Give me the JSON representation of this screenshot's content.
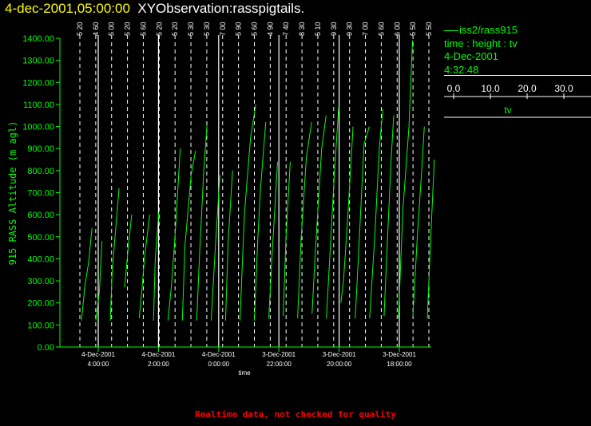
{
  "header": {
    "date_title": "4-dec-2001,05:00:00",
    "obs_title": "XYObservation:rasspigtails."
  },
  "legend": {
    "series": "iss2/rass915",
    "vars": "time : height : tv",
    "date": "4-Dec-2001",
    "time": "4:32:48",
    "scale_ticks": [
      "0.0",
      "10.0",
      "20.0",
      "30.0"
    ],
    "scale_label": "tv"
  },
  "footer": {
    "note": "Realtime data, not checked for quality"
  },
  "colors": {
    "title_date": "#ffff00",
    "title_obs": "#ffffff",
    "axis": "#00ff00",
    "trace": "#00ff00",
    "guide": "#ffffff",
    "footer": "#ff0000"
  },
  "chart_data": {
    "type": "line",
    "ylabel": "915 RASS Altitude (m agl)",
    "xlabel": "time",
    "ylim": [
      0,
      1400
    ],
    "y_ticks": [
      "0.00",
      "100.00",
      "200.00",
      "300.00",
      "400.00",
      "500.00",
      "600.00",
      "700.00",
      "800.00",
      "900.00",
      "1000.00",
      "1100.00",
      "1200.00",
      "1300.00",
      "1400.00"
    ],
    "x_ticks": [
      {
        "date": "4-Dec-2001",
        "time": "4:00:00"
      },
      {
        "date": "4-Dec-2001",
        "time": "2:00:00"
      },
      {
        "date": "4-Dec-2001",
        "time": "0:00:00"
      },
      {
        "date": "3-Dec-2001",
        "time": "22:00:00"
      },
      {
        "date": "3-Dec-2001",
        "time": "20:00:00"
      },
      {
        "date": "3-Dec-2001",
        "time": "18:00:00"
      }
    ],
    "profile_labels": [
      "5 20",
      "4 60",
      "5 00",
      "5 20",
      "5 60",
      "5 20",
      "5 20",
      "5 30",
      "5 30",
      "7 00",
      "5 90",
      "5 60",
      "4 90",
      "7 40",
      "8 30",
      "5 10",
      "9 30",
      "9 30",
      "7 00",
      "5 60",
      "6 00",
      "5 50",
      "5 50"
    ],
    "profiles": [
      {
        "points": [
          [
            0,
            120
          ],
          [
            0.4,
            280
          ],
          [
            0.8,
            380
          ],
          [
            1.2,
            540
          ]
        ]
      },
      {
        "points": [
          [
            0,
            120
          ],
          [
            0.4,
            250
          ],
          [
            0.7,
            480
          ]
        ]
      },
      {
        "points": [
          [
            0,
            120
          ],
          [
            0.2,
            330
          ],
          [
            0.6,
            530
          ],
          [
            1.0,
            720
          ]
        ]
      },
      {
        "points": [
          [
            0,
            270
          ],
          [
            0.4,
            450
          ],
          [
            0.8,
            600
          ]
        ]
      },
      {
        "points": [
          [
            0,
            130
          ],
          [
            0.3,
            250
          ],
          [
            0.6,
            400
          ],
          [
            1.2,
            600
          ]
        ]
      },
      {
        "points": [
          [
            0,
            120
          ],
          [
            0.2,
            400
          ],
          [
            0.6,
            610
          ]
        ]
      },
      {
        "points": [
          [
            0,
            120
          ],
          [
            0.4,
            280
          ],
          [
            0.8,
            500
          ],
          [
            1.4,
            900
          ]
        ]
      },
      {
        "points": [
          [
            0,
            120
          ],
          [
            0.3,
            460
          ],
          [
            1.0,
            780
          ],
          [
            1.5,
            890
          ]
        ]
      },
      {
        "points": [
          [
            0,
            120
          ],
          [
            0.3,
            400
          ],
          [
            0.8,
            800
          ],
          [
            1.2,
            1020
          ]
        ]
      },
      {
        "points": [
          [
            0,
            120
          ],
          [
            0.5,
            470
          ],
          [
            1.0,
            780
          ]
        ]
      },
      {
        "points": [
          [
            0,
            120
          ],
          [
            0.3,
            480
          ],
          [
            0.8,
            800
          ]
        ]
      },
      {
        "points": [
          [
            0,
            120
          ],
          [
            0.5,
            600
          ],
          [
            1.2,
            950
          ],
          [
            1.8,
            1100
          ]
        ]
      },
      {
        "points": [
          [
            0,
            120
          ],
          [
            0.4,
            500
          ],
          [
            0.7,
            720
          ],
          [
            1.3,
            1020
          ]
        ]
      },
      {
        "points": [
          [
            0,
            130
          ],
          [
            0.4,
            430
          ],
          [
            1.0,
            840
          ]
        ]
      },
      {
        "points": [
          [
            0,
            140
          ],
          [
            0.3,
            480
          ],
          [
            0.8,
            840
          ]
        ]
      },
      {
        "points": [
          [
            0,
            130
          ],
          [
            0.4,
            490
          ],
          [
            1.0,
            860
          ],
          [
            1.6,
            1020
          ]
        ]
      },
      {
        "points": [
          [
            0,
            150
          ],
          [
            0.4,
            450
          ],
          [
            1.1,
            900
          ],
          [
            1.6,
            1050
          ]
        ]
      },
      {
        "points": [
          [
            0,
            130
          ],
          [
            0.4,
            420
          ],
          [
            0.9,
            780
          ],
          [
            1.4,
            1090
          ]
        ]
      },
      {
        "points": [
          [
            0,
            200
          ],
          [
            0.3,
            300
          ],
          [
            0.8,
            600
          ],
          [
            1.4,
            1000
          ]
        ]
      },
      {
        "points": [
          [
            0,
            130
          ],
          [
            0.5,
            520
          ],
          [
            1.0,
            920
          ],
          [
            1.6,
            1000
          ]
        ]
      },
      {
        "points": [
          [
            0,
            130
          ],
          [
            0.6,
            510
          ],
          [
            1.1,
            900
          ],
          [
            1.5,
            1080
          ]
        ]
      },
      {
        "points": [
          [
            0,
            140
          ],
          [
            0.4,
            500
          ],
          [
            0.8,
            850
          ],
          [
            1.1,
            1050
          ]
        ]
      },
      {
        "points": [
          [
            0,
            130
          ],
          [
            0.5,
            620
          ],
          [
            1.2,
            1000
          ],
          [
            1.6,
            1390
          ]
        ]
      },
      {
        "points": [
          [
            0,
            140
          ],
          [
            0.5,
            500
          ],
          [
            1.0,
            800
          ],
          [
            1.3,
            1000
          ]
        ]
      },
      {
        "points": [
          [
            0,
            130
          ],
          [
            0.4,
            500
          ],
          [
            0.8,
            850
          ]
        ]
      }
    ]
  }
}
